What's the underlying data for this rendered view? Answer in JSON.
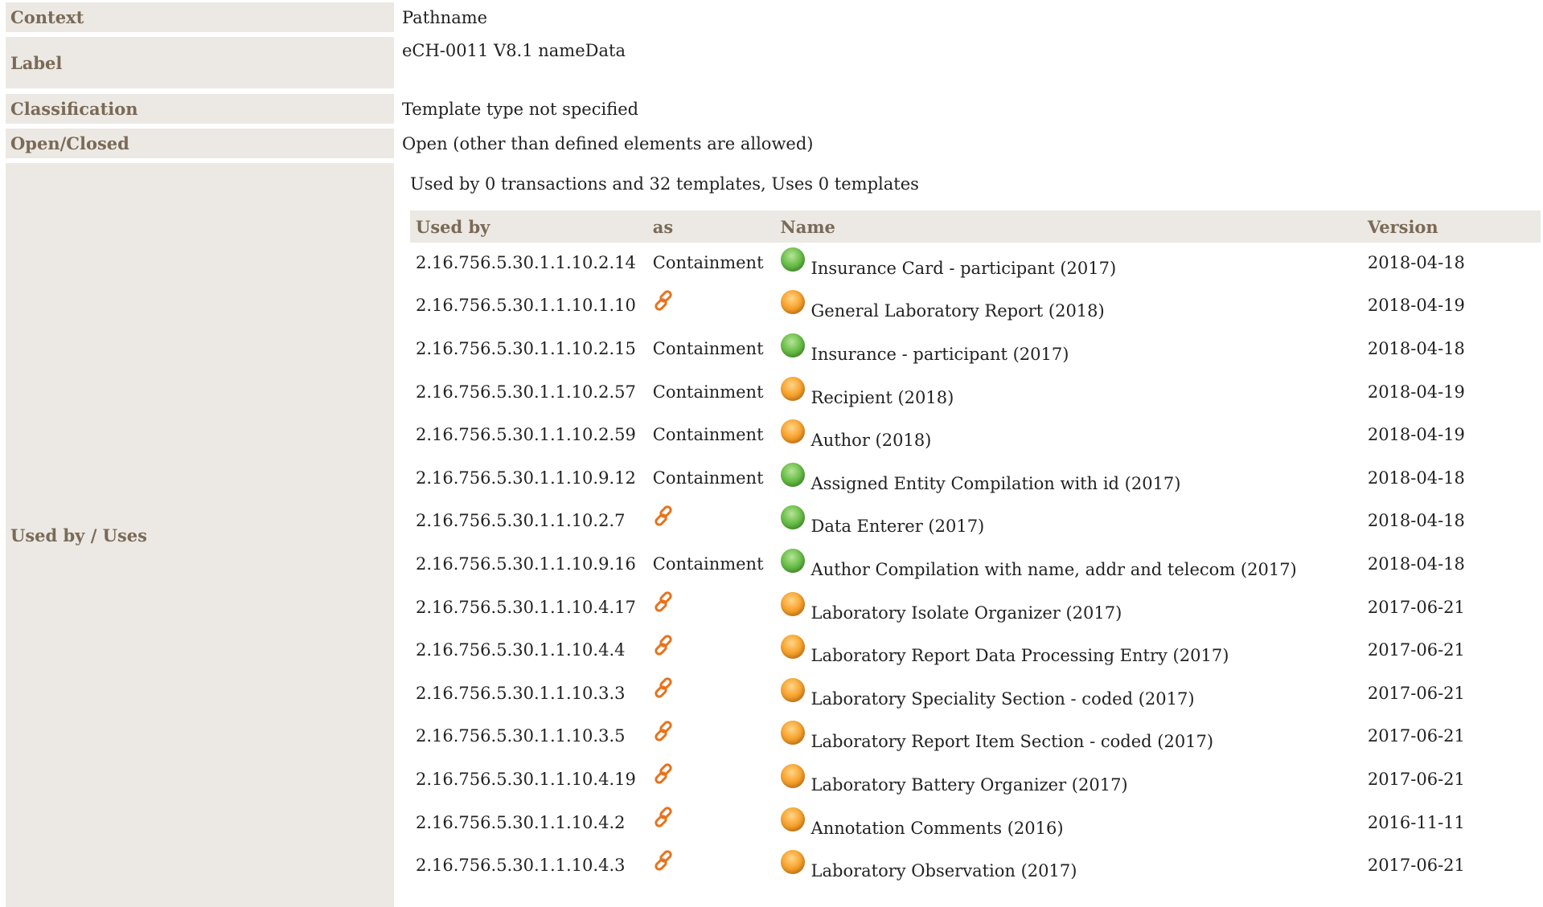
{
  "details": {
    "context_label": "Context",
    "context_value": "Pathname",
    "label_label": "Label",
    "label_value": "eCH-0011 V8.1 nameData",
    "classification_label": "Classification",
    "classification_value": "Template type not specified",
    "openclosed_label": "Open/Closed",
    "openclosed_value": "Open (other than defined elements are allowed)",
    "usedby_label": "Used by / Uses"
  },
  "usage": {
    "summary": "Used by 0 transactions and 32 templates, Uses 0 templates",
    "headers": {
      "used_by": "Used by",
      "as": "as",
      "name": "Name",
      "version": "Version"
    },
    "rows": [
      {
        "id": "2.16.756.5.30.1.1.10.2.14",
        "as": "Containment",
        "status": "green",
        "name": "Insurance Card - participant (2017)",
        "version": "2018-04-18"
      },
      {
        "id": "2.16.756.5.30.1.1.10.1.10",
        "as": "link-icon",
        "status": "orange",
        "name": "General Laboratory Report (2018)",
        "version": "2018-04-19"
      },
      {
        "id": "2.16.756.5.30.1.1.10.2.15",
        "as": "Containment",
        "status": "green",
        "name": "Insurance - participant (2017)",
        "version": "2018-04-18"
      },
      {
        "id": "2.16.756.5.30.1.1.10.2.57",
        "as": "Containment",
        "status": "orange",
        "name": "Recipient (2018)",
        "version": "2018-04-19"
      },
      {
        "id": "2.16.756.5.30.1.1.10.2.59",
        "as": "Containment",
        "status": "orange",
        "name": "Author (2018)",
        "version": "2018-04-19"
      },
      {
        "id": "2.16.756.5.30.1.1.10.9.12",
        "as": "Containment",
        "status": "green",
        "name": "Assigned Entity Compilation with id (2017)",
        "version": "2018-04-18"
      },
      {
        "id": "2.16.756.5.30.1.1.10.2.7",
        "as": "link-icon",
        "status": "green",
        "name": "Data Enterer (2017)",
        "version": "2018-04-18"
      },
      {
        "id": "2.16.756.5.30.1.1.10.9.16",
        "as": "Containment",
        "status": "green",
        "name": "Author Compilation with name, addr and telecom (2017)",
        "version": "2018-04-18"
      },
      {
        "id": "2.16.756.5.30.1.1.10.4.17",
        "as": "link-icon",
        "status": "orange",
        "name": "Laboratory Isolate Organizer (2017)",
        "version": "2017-06-21"
      },
      {
        "id": "2.16.756.5.30.1.1.10.4.4",
        "as": "link-icon",
        "status": "orange",
        "name": "Laboratory Report Data Processing Entry (2017)",
        "version": "2017-06-21"
      },
      {
        "id": "2.16.756.5.30.1.1.10.3.3",
        "as": "link-icon",
        "status": "orange",
        "name": "Laboratory Speciality Section - coded (2017)",
        "version": "2017-06-21"
      },
      {
        "id": "2.16.756.5.30.1.1.10.3.5",
        "as": "link-icon",
        "status": "orange",
        "name": "Laboratory Report Item Section - coded (2017)",
        "version": "2017-06-21"
      },
      {
        "id": "2.16.756.5.30.1.1.10.4.19",
        "as": "link-icon",
        "status": "orange",
        "name": "Laboratory Battery Organizer (2017)",
        "version": "2017-06-21"
      },
      {
        "id": "2.16.756.5.30.1.1.10.4.2",
        "as": "link-icon",
        "status": "orange",
        "name": "Annotation Comments (2016)",
        "version": "2016-11-11"
      },
      {
        "id": "2.16.756.5.30.1.1.10.4.3",
        "as": "link-icon",
        "status": "orange",
        "name": "Laboratory Observation (2017)",
        "version": "2017-06-21"
      }
    ]
  },
  "colors": {
    "label_bg": "#ece9e4",
    "label_text": "#7a6a57",
    "link_icon": "#e8731c"
  }
}
